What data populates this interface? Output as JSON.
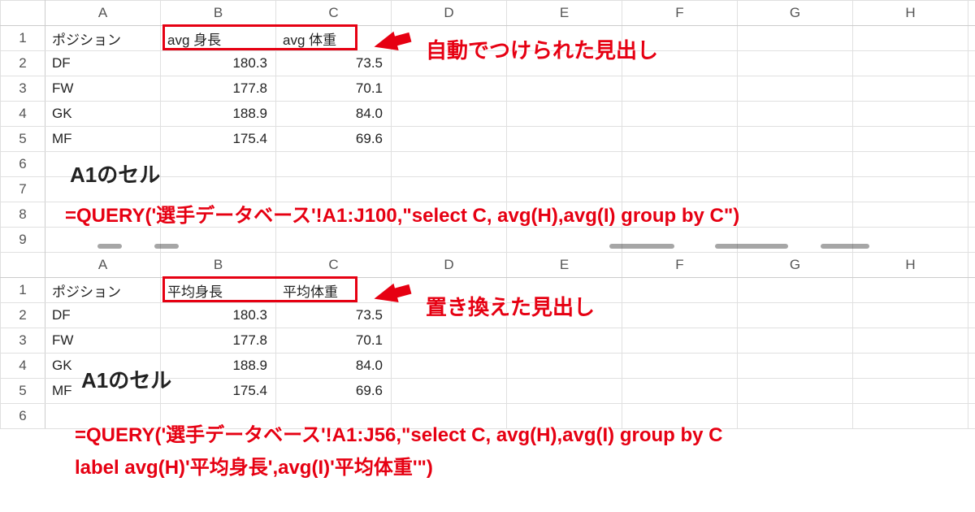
{
  "columns": [
    "A",
    "B",
    "C",
    "D",
    "E",
    "F",
    "G",
    "H"
  ],
  "rows": [
    "1",
    "2",
    "3",
    "4",
    "5",
    "6",
    "7",
    "8",
    "9"
  ],
  "rows2": [
    "1",
    "2",
    "3",
    "4",
    "5",
    "6"
  ],
  "top": {
    "a1": "ポジション",
    "b1": "avg 身長",
    "c1": "avg 体重",
    "data": [
      {
        "pos": "DF",
        "h": "180.3",
        "w": "73.5"
      },
      {
        "pos": "FW",
        "h": "177.8",
        "w": "70.1"
      },
      {
        "pos": "GK",
        "h": "188.9",
        "w": "84.0"
      },
      {
        "pos": "MF",
        "h": "175.4",
        "w": "69.6"
      }
    ],
    "callout": "自動でつけられた見出し",
    "cell_label": "A1のセル",
    "formula": "=QUERY('選手データベース'!A1:J100,\"select C, avg(H),avg(I) group by C\")"
  },
  "bottom": {
    "a1": "ポジション",
    "b1": "平均身長",
    "c1": "平均体重",
    "data": [
      {
        "pos": "DF",
        "h": "180.3",
        "w": "73.5"
      },
      {
        "pos": "FW",
        "h": "177.8",
        "w": "70.1"
      },
      {
        "pos": "GK",
        "h": "188.9",
        "w": "84.0"
      },
      {
        "pos": "MF",
        "h": "175.4",
        "w": "69.6"
      }
    ],
    "callout": "置き換えた見出し",
    "cell_label": "A1のセル",
    "formula_l1": "=QUERY('選手データベース'!A1:J56,\"select C, avg(H),avg(I) group by C",
    "formula_l2": "label avg(H)'平均身長',avg(I)'平均体重'\")"
  }
}
